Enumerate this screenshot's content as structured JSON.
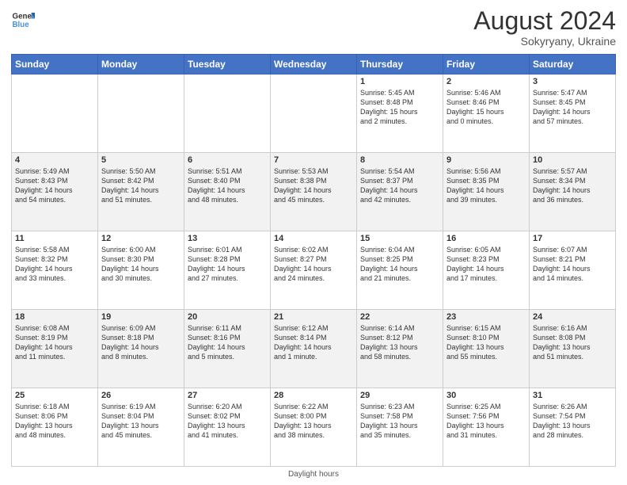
{
  "header": {
    "logo_line1": "General",
    "logo_line2": "Blue",
    "month_year": "August 2024",
    "location": "Sokyryany, Ukraine"
  },
  "days_of_week": [
    "Sunday",
    "Monday",
    "Tuesday",
    "Wednesday",
    "Thursday",
    "Friday",
    "Saturday"
  ],
  "footer": {
    "note": "Daylight hours"
  },
  "weeks": [
    [
      {
        "num": "",
        "info": ""
      },
      {
        "num": "",
        "info": ""
      },
      {
        "num": "",
        "info": ""
      },
      {
        "num": "",
        "info": ""
      },
      {
        "num": "1",
        "info": "Sunrise: 5:45 AM\nSunset: 8:48 PM\nDaylight: 15 hours\nand 2 minutes."
      },
      {
        "num": "2",
        "info": "Sunrise: 5:46 AM\nSunset: 8:46 PM\nDaylight: 15 hours\nand 0 minutes."
      },
      {
        "num": "3",
        "info": "Sunrise: 5:47 AM\nSunset: 8:45 PM\nDaylight: 14 hours\nand 57 minutes."
      }
    ],
    [
      {
        "num": "4",
        "info": "Sunrise: 5:49 AM\nSunset: 8:43 PM\nDaylight: 14 hours\nand 54 minutes."
      },
      {
        "num": "5",
        "info": "Sunrise: 5:50 AM\nSunset: 8:42 PM\nDaylight: 14 hours\nand 51 minutes."
      },
      {
        "num": "6",
        "info": "Sunrise: 5:51 AM\nSunset: 8:40 PM\nDaylight: 14 hours\nand 48 minutes."
      },
      {
        "num": "7",
        "info": "Sunrise: 5:53 AM\nSunset: 8:38 PM\nDaylight: 14 hours\nand 45 minutes."
      },
      {
        "num": "8",
        "info": "Sunrise: 5:54 AM\nSunset: 8:37 PM\nDaylight: 14 hours\nand 42 minutes."
      },
      {
        "num": "9",
        "info": "Sunrise: 5:56 AM\nSunset: 8:35 PM\nDaylight: 14 hours\nand 39 minutes."
      },
      {
        "num": "10",
        "info": "Sunrise: 5:57 AM\nSunset: 8:34 PM\nDaylight: 14 hours\nand 36 minutes."
      }
    ],
    [
      {
        "num": "11",
        "info": "Sunrise: 5:58 AM\nSunset: 8:32 PM\nDaylight: 14 hours\nand 33 minutes."
      },
      {
        "num": "12",
        "info": "Sunrise: 6:00 AM\nSunset: 8:30 PM\nDaylight: 14 hours\nand 30 minutes."
      },
      {
        "num": "13",
        "info": "Sunrise: 6:01 AM\nSunset: 8:28 PM\nDaylight: 14 hours\nand 27 minutes."
      },
      {
        "num": "14",
        "info": "Sunrise: 6:02 AM\nSunset: 8:27 PM\nDaylight: 14 hours\nand 24 minutes."
      },
      {
        "num": "15",
        "info": "Sunrise: 6:04 AM\nSunset: 8:25 PM\nDaylight: 14 hours\nand 21 minutes."
      },
      {
        "num": "16",
        "info": "Sunrise: 6:05 AM\nSunset: 8:23 PM\nDaylight: 14 hours\nand 17 minutes."
      },
      {
        "num": "17",
        "info": "Sunrise: 6:07 AM\nSunset: 8:21 PM\nDaylight: 14 hours\nand 14 minutes."
      }
    ],
    [
      {
        "num": "18",
        "info": "Sunrise: 6:08 AM\nSunset: 8:19 PM\nDaylight: 14 hours\nand 11 minutes."
      },
      {
        "num": "19",
        "info": "Sunrise: 6:09 AM\nSunset: 8:18 PM\nDaylight: 14 hours\nand 8 minutes."
      },
      {
        "num": "20",
        "info": "Sunrise: 6:11 AM\nSunset: 8:16 PM\nDaylight: 14 hours\nand 5 minutes."
      },
      {
        "num": "21",
        "info": "Sunrise: 6:12 AM\nSunset: 8:14 PM\nDaylight: 14 hours\nand 1 minute."
      },
      {
        "num": "22",
        "info": "Sunrise: 6:14 AM\nSunset: 8:12 PM\nDaylight: 13 hours\nand 58 minutes."
      },
      {
        "num": "23",
        "info": "Sunrise: 6:15 AM\nSunset: 8:10 PM\nDaylight: 13 hours\nand 55 minutes."
      },
      {
        "num": "24",
        "info": "Sunrise: 6:16 AM\nSunset: 8:08 PM\nDaylight: 13 hours\nand 51 minutes."
      }
    ],
    [
      {
        "num": "25",
        "info": "Sunrise: 6:18 AM\nSunset: 8:06 PM\nDaylight: 13 hours\nand 48 minutes."
      },
      {
        "num": "26",
        "info": "Sunrise: 6:19 AM\nSunset: 8:04 PM\nDaylight: 13 hours\nand 45 minutes."
      },
      {
        "num": "27",
        "info": "Sunrise: 6:20 AM\nSunset: 8:02 PM\nDaylight: 13 hours\nand 41 minutes."
      },
      {
        "num": "28",
        "info": "Sunrise: 6:22 AM\nSunset: 8:00 PM\nDaylight: 13 hours\nand 38 minutes."
      },
      {
        "num": "29",
        "info": "Sunrise: 6:23 AM\nSunset: 7:58 PM\nDaylight: 13 hours\nand 35 minutes."
      },
      {
        "num": "30",
        "info": "Sunrise: 6:25 AM\nSunset: 7:56 PM\nDaylight: 13 hours\nand 31 minutes."
      },
      {
        "num": "31",
        "info": "Sunrise: 6:26 AM\nSunset: 7:54 PM\nDaylight: 13 hours\nand 28 minutes."
      }
    ]
  ]
}
